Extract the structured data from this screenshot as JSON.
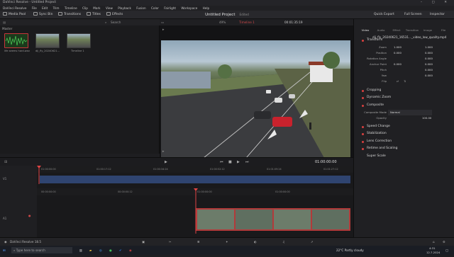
{
  "titlebar": {
    "title": "DaVinci Resolve - Untitled Project",
    "controls": "–  ▢  ✕"
  },
  "menu": [
    "DaVinci Resolve",
    "File",
    "Edit",
    "Trim",
    "Timeline",
    "Clip",
    "Mark",
    "View",
    "Playback",
    "Fusion",
    "Color",
    "Fairlight",
    "Workspace",
    "Help"
  ],
  "toolbar": {
    "media_pool": "Media Pool",
    "sync_bin": "Sync Bin",
    "transitions": "Transitions",
    "titles": "Titles",
    "effects": "Effects",
    "project_title": "Untitled Project",
    "edited": "Edited",
    "quick_export": "Quick Export",
    "full_screen": "Full Screen",
    "inspector": "Inspector"
  },
  "pool": {
    "master": "Master",
    "search": "Search",
    "clips": [
      {
        "label": "life seems hard.wav",
        "kind": "audio"
      },
      {
        "label": "dji_fly_20240621...",
        "kind": "video"
      },
      {
        "label": "Timeline 1",
        "kind": "timeline"
      }
    ]
  },
  "viewer": {
    "zoom": "49%",
    "timeline_name": "Timeline 1",
    "source_tc": "00:01:35:19",
    "current_tc": "01:00:00:00",
    "transport_icons": [
      "skip-back-icon",
      "step-back-icon",
      "stop-icon",
      "play-icon",
      "skip-forward-icon",
      "loop-icon"
    ]
  },
  "inspector": {
    "tabs": [
      "Video",
      "Audio",
      "Effect",
      "Transition",
      "Image",
      "File"
    ],
    "clip_name": "dji_fly_20240621_16531..._video_low_quality.mp4",
    "sections": [
      {
        "name": "Transform"
      },
      {
        "name": "Cropping"
      },
      {
        "name": "Dynamic Zoom"
      },
      {
        "name": "Composite"
      },
      {
        "name": "Speed Change"
      },
      {
        "name": "Stabilization"
      },
      {
        "name": "Lens Correction"
      },
      {
        "name": "Retime and Scaling"
      },
      {
        "name": "Super Scale"
      }
    ],
    "transform": {
      "zoom_label": "Zoom",
      "zoom_x": "1.000",
      "zoom_y": "1.000",
      "position_label": "Position",
      "pos_x": "0.000",
      "pos_y": "0.000",
      "rotation_label": "Rotation Angle",
      "rotation": "0.000",
      "anchor_label": "Anchor Point",
      "anchor_x": "0.000",
      "anchor_y": "0.000",
      "pitch_label": "Pitch",
      "pitch": "0.000",
      "yaw_label": "Yaw",
      "yaw": "0.000",
      "flip_label": "Flip"
    },
    "composite": {
      "mode_label": "Composite Mode",
      "mode": "Normal",
      "opacity_label": "Opacity",
      "opacity": "100.00"
    }
  },
  "timeline": {
    "ruler_top": [
      "01:00:00:00",
      "01:00:17:12",
      "01:00:34:24",
      "01:00:52:12",
      "01:01:09:24",
      "01:01:27:12"
    ],
    "ruler_bottom": [
      "00:00:00:00",
      "00:00:00:12",
      "01:00:00:00",
      "01:00:00:00"
    ],
    "track_v": "V1",
    "track_a": "A1"
  },
  "bottom": {
    "app": "DaVinci Resolve 18.5"
  },
  "taskbar": {
    "search_placeholder": "Type here to search",
    "weather": "22°C  Partly cloudy",
    "time": "4:31",
    "date": "12.7.2024"
  }
}
